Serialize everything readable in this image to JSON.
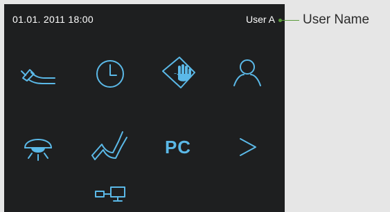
{
  "status_bar": {
    "datetime": "01.01. 2011 18:00",
    "user": "User A"
  },
  "callout": {
    "label": "User Name",
    "color": "#5a9a3a"
  },
  "accent_color": "#5bb9e8",
  "menu": {
    "row1": [
      "handpiece-icon",
      "clock-icon",
      "touch-screen-hand-icon",
      "user-profile-icon"
    ],
    "row2": [
      "operating-light-icon",
      "dental-chair-icon",
      "pc-icon",
      "next-arrow-icon"
    ],
    "row3": [
      "network-connection-icon"
    ],
    "pc_label": "PC"
  }
}
